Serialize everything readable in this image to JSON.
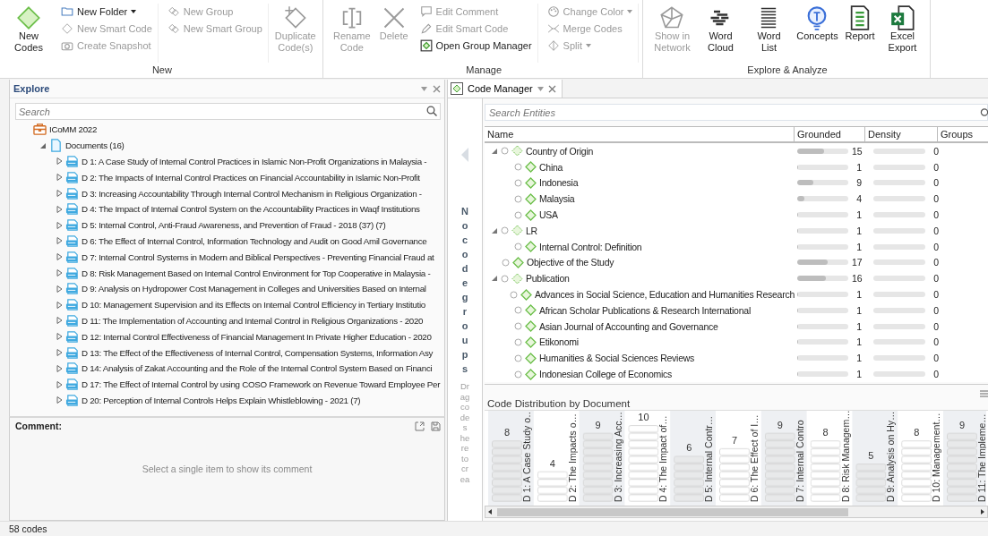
{
  "ribbon": {
    "groups": [
      {
        "label": "New",
        "columns": [
          {
            "kind": "large",
            "items": [
              {
                "label": "New Codes",
                "disabled": false
              }
            ]
          },
          {
            "kind": "small",
            "items": [
              {
                "label": "New Folder",
                "disabled": false,
                "dropdown": true
              },
              {
                "label": "New Smart Code",
                "disabled": true,
                "dropdown": false
              },
              {
                "label": "Create Snapshot",
                "disabled": true,
                "dropdown": false
              }
            ]
          },
          {
            "kind": "small",
            "items": [
              {
                "label": "New Group",
                "disabled": true,
                "dropdown": false
              },
              {
                "label": "New Smart Group",
                "disabled": true,
                "dropdown": false
              }
            ]
          },
          {
            "kind": "large",
            "items": [
              {
                "label": "Duplicate Code(s)",
                "disabled": true
              }
            ]
          }
        ]
      },
      {
        "label": "Manage",
        "columns": [
          {
            "kind": "large",
            "items": [
              {
                "label": "Rename Code",
                "disabled": true
              },
              {
                "label": "Delete",
                "disabled": true
              }
            ]
          },
          {
            "kind": "small",
            "items": [
              {
                "label": "Edit Comment",
                "disabled": true,
                "dropdown": false
              },
              {
                "label": "Edit Smart Code",
                "disabled": true,
                "dropdown": false
              },
              {
                "label": "Open Group Manager",
                "disabled": false,
                "dropdown": false
              }
            ]
          },
          {
            "kind": "small",
            "items": [
              {
                "label": "Change Color",
                "disabled": true,
                "dropdown": true
              },
              {
                "label": "Merge Codes",
                "disabled": true,
                "dropdown": false
              },
              {
                "label": "Split",
                "disabled": true,
                "dropdown": true
              }
            ]
          }
        ]
      },
      {
        "label": "Explore & Analyze",
        "columns": [
          {
            "kind": "large",
            "items": [
              {
                "label": "Show in Network",
                "disabled": true
              },
              {
                "label": "Word Cloud",
                "disabled": false
              },
              {
                "label": "Word List",
                "disabled": false
              },
              {
                "label": "Concepts",
                "disabled": false
              },
              {
                "label": "Report",
                "disabled": false
              },
              {
                "label": "Excel Export",
                "disabled": false
              }
            ]
          }
        ]
      }
    ]
  },
  "explore": {
    "title": "Explore",
    "search": {
      "placeholder": "Search"
    },
    "tree": [
      {
        "label": "ICoMM 2022",
        "kind": "project",
        "children": [
          {
            "label": "Documents (16)",
            "kind": "folder",
            "expanded": true,
            "children": [
              {
                "label": "D 1: A Case Study of Internal Control Practices in Islamic Non-Profit Organizations in Malaysia -",
                "kind": "document",
                "expanded": false
              },
              {
                "label": "D 2: The Impacts of Internal Control Practices on Financial Accountability in Islamic Non-Profit",
                "kind": "document",
                "expanded": false
              },
              {
                "label": "D 3: Increasing Accountability Through Internal Control Mechanism in Religious Organization -",
                "kind": "document",
                "expanded": false
              },
              {
                "label": "D 4: The Impact of Internal Control System on the Accountability Practices in Waqf Institutions",
                "kind": "document",
                "expanded": false
              },
              {
                "label": "D 5: Internal Control, Anti-Fraud Awareness, and Prevention of Fraud - 2018 (37) (7)",
                "kind": "document",
                "expanded": false
              },
              {
                "label": "D 6: The Effect of Internal Control, Information Technology and Audit on Good Amil Governance",
                "kind": "document",
                "expanded": false
              },
              {
                "label": "D 7: Internal Control Systems in Modern and Biblical Perspectives - Preventing Financial Fraud at",
                "kind": "document",
                "expanded": false
              },
              {
                "label": "D 8: Risk Management Based on Internal Control Environment for Top Cooperative in Malaysia -",
                "kind": "document",
                "expanded": false
              },
              {
                "label": "D 9: Analysis on Hydropower Cost Management in Colleges and Universities Based on Internal",
                "kind": "document",
                "expanded": false
              },
              {
                "label": "D 10: Management Supervision and its Effects on Internal Control Efficiency in Tertiary Institutio",
                "kind": "document",
                "expanded": false
              },
              {
                "label": "D 11: The Implementation of Accounting and Internal Control in Religious Organizations - 2020",
                "kind": "document",
                "expanded": false
              },
              {
                "label": "D 12: Internal Control Effectiveness of Financial Management In Private Higher Education - 2020",
                "kind": "document",
                "expanded": false
              },
              {
                "label": "D 13: The Effect of the Effectiveness of Internal Control, Compensation Systems, Information Asy",
                "kind": "document",
                "expanded": false
              },
              {
                "label": "D 14: Analysis of Zakat Accounting and the Role of the Internal Control System Based on Financi",
                "kind": "document",
                "expanded": false
              },
              {
                "label": "D 17: The Effect of Internal Control by using COSO Framework on Revenue Toward Employee Per",
                "kind": "document",
                "expanded": false
              },
              {
                "label": "D 20: Perception of Internal Controls Helps Explain Whistleblowing - 2021 (7)",
                "kind": "document",
                "expanded": false
              }
            ]
          }
        ]
      }
    ]
  },
  "comment": {
    "title": "Comment:",
    "message": "Select a single item to show its comment"
  },
  "code_manager": {
    "tab": {
      "label": "Code Manager",
      "selected": true
    },
    "groups_panel": {
      "message": "No code groups",
      "hint": "Drag codes here to crea"
    },
    "search": {
      "placeholder": "Search Entities"
    },
    "table": {
      "columns": [
        "Name",
        "Grounded",
        "Density",
        "Groups"
      ],
      "rows": [
        {
          "name": "Country of Origin",
          "expanded": true,
          "grounded": {
            "value": "15",
            "level": 0.53
          },
          "density": {
            "value": "0",
            "level": 0
          },
          "children": [
            {
              "name": "China",
              "grounded": {
                "value": "1",
                "level": 0.02
              },
              "density": {
                "value": "0",
                "level": 0
              }
            },
            {
              "name": "Indonesia",
              "grounded": {
                "value": "9",
                "level": 0.32
              },
              "density": {
                "value": "0",
                "level": 0
              }
            },
            {
              "name": "Malaysia",
              "grounded": {
                "value": "4",
                "level": 0.14
              },
              "density": {
                "value": "0",
                "level": 0
              }
            },
            {
              "name": "USA",
              "grounded": {
                "value": "1",
                "level": 0.02
              },
              "density": {
                "value": "0",
                "level": 0
              }
            }
          ]
        },
        {
          "name": "LR",
          "expanded": true,
          "grounded": {
            "value": "1",
            "level": 0.02
          },
          "density": {
            "value": "0",
            "level": 0
          },
          "children": [
            {
              "name": "Internal Control: Definition",
              "grounded": {
                "value": "1",
                "level": 0.02
              },
              "density": {
                "value": "0",
                "level": 0
              }
            }
          ]
        },
        {
          "name": "Objective of the Study",
          "grounded": {
            "value": "17",
            "level": 0.6
          },
          "density": {
            "value": "0",
            "level": 0
          }
        },
        {
          "name": "Publication",
          "expanded": true,
          "grounded": {
            "value": "16",
            "level": 0.57
          },
          "density": {
            "value": "0",
            "level": 0
          },
          "children": [
            {
              "name": "Advances in Social Science, Education and Humanities Research",
              "grounded": {
                "value": "1",
                "level": 0.02
              },
              "density": {
                "value": "0",
                "level": 0
              }
            },
            {
              "name": "African Scholar Publications & Research International",
              "grounded": {
                "value": "1",
                "level": 0.02
              },
              "density": {
                "value": "0",
                "level": 0
              }
            },
            {
              "name": "Asian Journal of Accounting and Governance",
              "grounded": {
                "value": "1",
                "level": 0.02
              },
              "density": {
                "value": "0",
                "level": 0
              }
            },
            {
              "name": "Etikonomi",
              "grounded": {
                "value": "1",
                "level": 0.02
              },
              "density": {
                "value": "0",
                "level": 0
              }
            },
            {
              "name": "Humanities & Social Sciences Reviews",
              "grounded": {
                "value": "1",
                "level": 0.02
              },
              "density": {
                "value": "0",
                "level": 0
              }
            },
            {
              "name": "Indonesian College of Economics",
              "grounded": {
                "value": "1",
                "level": 0.02
              },
              "density": {
                "value": "0",
                "level": 0
              }
            }
          ]
        }
      ]
    },
    "chart_data": {
      "type": "bar",
      "title": "Code Distribution by Document",
      "categories": [
        "D 1: A Case Study o…",
        "D 2: The Impacts o…",
        "D 3: Increasing Acc…",
        "D 4: The Impact of…",
        "D 5: Internal Contr…",
        "D 6: The Effect of I…",
        "D 7: Internal Contro",
        "D 8: Risk Managem…",
        "D 9: Analysis on Hy…",
        "D 10: Management…",
        "D 11: The Impleme…"
      ],
      "values": [
        8,
        4,
        9,
        10,
        6,
        7,
        9,
        8,
        5,
        8,
        9
      ],
      "data_labels": true
    }
  },
  "status_bar": {
    "text": "58 codes"
  }
}
